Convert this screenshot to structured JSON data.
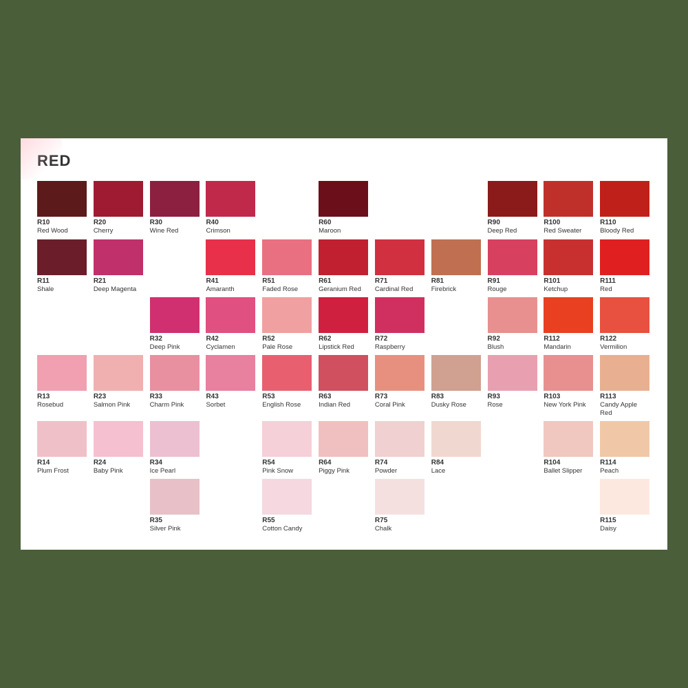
{
  "page": {
    "title": "RED",
    "background_color": "#4a5e3a",
    "card_bg": "#ffffff"
  },
  "colors": [
    {
      "code": "R10",
      "name": "Red Wood",
      "hex": "#5c1a1a",
      "col": 1,
      "row": 1
    },
    {
      "code": "R20",
      "name": "Cherry",
      "hex": "#9e1b32",
      "col": 2,
      "row": 1
    },
    {
      "code": "R30",
      "name": "Wine Red",
      "hex": "#8b2040",
      "col": 3,
      "row": 1
    },
    {
      "code": "R40",
      "name": "Crimson",
      "hex": "#c0294a",
      "col": 4,
      "row": 1
    },
    {
      "code": "R60",
      "name": "Maroon",
      "hex": "#6b0f1a",
      "col": 6,
      "row": 1
    },
    {
      "code": "R90",
      "name": "Deep Red",
      "hex": "#8b1a1a",
      "col": 9,
      "row": 1
    },
    {
      "code": "R100",
      "name": "Red Sweater",
      "hex": "#c0302a",
      "col": 10,
      "row": 1
    },
    {
      "code": "R110",
      "name": "Bloody Red",
      "hex": "#c0201a",
      "col": 11,
      "row": 1
    },
    {
      "code": "R11",
      "name": "Shale",
      "hex": "#6b1e2a",
      "col": 1,
      "row": 2
    },
    {
      "code": "R21",
      "name": "Deep Magenta",
      "hex": "#c0306a",
      "col": 2,
      "row": 2
    },
    {
      "code": "R41",
      "name": "Amaranth",
      "hex": "#e8304a",
      "col": 4,
      "row": 2
    },
    {
      "code": "R51",
      "name": "Faded Rose",
      "hex": "#e87080",
      "col": 5,
      "row": 2
    },
    {
      "code": "R61",
      "name": "Geranium Red",
      "hex": "#c02030",
      "col": 6,
      "row": 2
    },
    {
      "code": "R71",
      "name": "Cardinal Red",
      "hex": "#d03040",
      "col": 7,
      "row": 2
    },
    {
      "code": "R81",
      "name": "Firebrick",
      "hex": "#c07050",
      "col": 8,
      "row": 2
    },
    {
      "code": "R91",
      "name": "Rouge",
      "hex": "#d84060",
      "col": 9,
      "row": 2
    },
    {
      "code": "R101",
      "name": "Ketchup",
      "hex": "#c83030",
      "col": 10,
      "row": 2
    },
    {
      "code": "R111",
      "name": "Red",
      "hex": "#e02020",
      "col": 11,
      "row": 2
    },
    {
      "code": "R32",
      "name": "Deep Pink",
      "hex": "#d03070",
      "col": 3,
      "row": 3
    },
    {
      "code": "R42",
      "name": "Cyclamen",
      "hex": "#e05080",
      "col": 4,
      "row": 3
    },
    {
      "code": "R52",
      "name": "Pale Rose",
      "hex": "#f0a0a0",
      "col": 5,
      "row": 3
    },
    {
      "code": "R62",
      "name": "Lipstick Red",
      "hex": "#d02040",
      "col": 6,
      "row": 3
    },
    {
      "code": "R72",
      "name": "Raspberry",
      "hex": "#d03060",
      "col": 7,
      "row": 3
    },
    {
      "code": "R92",
      "name": "Blush",
      "hex": "#e89090",
      "col": 9,
      "row": 3
    },
    {
      "code": "R112",
      "name": "Mandarin",
      "hex": "#e84020",
      "col": 10,
      "row": 3
    },
    {
      "code": "R122",
      "name": "Vermilion",
      "hex": "#e85040",
      "col": 11,
      "row": 3
    },
    {
      "code": "R13",
      "name": "Rosebud",
      "hex": "#f0a0b0",
      "col": 1,
      "row": 4
    },
    {
      "code": "R23",
      "name": "Salmon Pink",
      "hex": "#f0b0b0",
      "col": 2,
      "row": 4
    },
    {
      "code": "R33",
      "name": "Charm Pink",
      "hex": "#e890a0",
      "col": 3,
      "row": 4
    },
    {
      "code": "R43",
      "name": "Sorbet",
      "hex": "#e880a0",
      "col": 4,
      "row": 4
    },
    {
      "code": "R53",
      "name": "English Rose",
      "hex": "#e86070",
      "col": 5,
      "row": 4
    },
    {
      "code": "R63",
      "name": "Indian Red",
      "hex": "#d05060",
      "col": 6,
      "row": 4
    },
    {
      "code": "R73",
      "name": "Coral Pink",
      "hex": "#e89080",
      "col": 7,
      "row": 4
    },
    {
      "code": "R83",
      "name": "Dusky Rose",
      "hex": "#d0a090",
      "col": 8,
      "row": 4
    },
    {
      "code": "R93",
      "name": "Rose",
      "hex": "#e8a0b0",
      "col": 9,
      "row": 4
    },
    {
      "code": "R103",
      "name": "New York Pink",
      "hex": "#e89090",
      "col": 10,
      "row": 4
    },
    {
      "code": "R113",
      "name": "Candy Apple Red",
      "hex": "#e8b090",
      "col": 11,
      "row": 4
    },
    {
      "code": "R14",
      "name": "Plum Frost",
      "hex": "#f0c0c8",
      "col": 1,
      "row": 5
    },
    {
      "code": "R24",
      "name": "Baby Pink",
      "hex": "#f5c0d0",
      "col": 2,
      "row": 5
    },
    {
      "code": "R34",
      "name": "Ice Pearl",
      "hex": "#ecc0d0",
      "col": 3,
      "row": 5
    },
    {
      "code": "R54",
      "name": "Pink Snow",
      "hex": "#f5d0d8",
      "col": 5,
      "row": 5
    },
    {
      "code": "R64",
      "name": "Piggy Pink",
      "hex": "#f0c0c0",
      "col": 6,
      "row": 5
    },
    {
      "code": "R74",
      "name": "Powder",
      "hex": "#f0d0d0",
      "col": 7,
      "row": 5
    },
    {
      "code": "R84",
      "name": "Lace",
      "hex": "#f0d8d0",
      "col": 8,
      "row": 5
    },
    {
      "code": "R104",
      "name": "Ballet Slipper",
      "hex": "#f0c8c0",
      "col": 10,
      "row": 5
    },
    {
      "code": "R114",
      "name": "Peach",
      "hex": "#f0c8a8",
      "col": 11,
      "row": 5
    },
    {
      "code": "R35",
      "name": "Silver Pink",
      "hex": "#e8c0c8",
      "col": 3,
      "row": 6
    },
    {
      "code": "R55",
      "name": "Cotton Candy",
      "hex": "#f5d8e0",
      "col": 5,
      "row": 6
    },
    {
      "code": "R75",
      "name": "Chalk",
      "hex": "#f5e0e0",
      "col": 7,
      "row": 6
    },
    {
      "code": "R115",
      "name": "Daisy",
      "hex": "#fde8e0",
      "col": 11,
      "row": 6
    }
  ]
}
